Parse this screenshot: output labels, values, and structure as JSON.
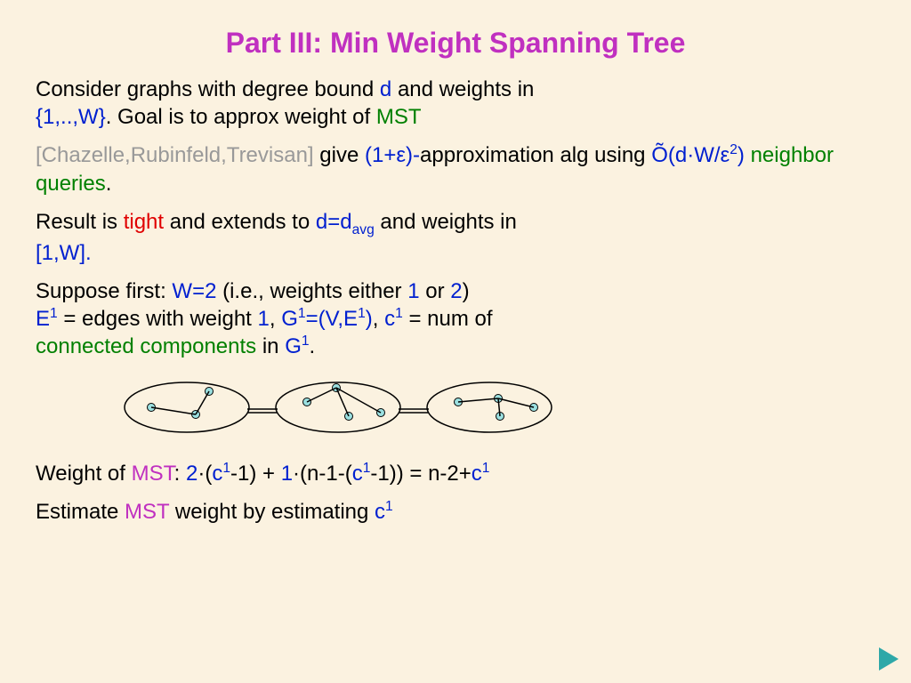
{
  "title": "Part III: Min Weight Spanning Tree",
  "p1": {
    "t1": "Consider graphs with degree bound ",
    "d": "d",
    "t2": " and weights in",
    "set": "{1,..,W}",
    "t3": ". Goal is to approx weight of ",
    "mst": "MST"
  },
  "p2": {
    "cite": "[Chazelle,Rubinfeld,Trevisan]",
    "t1": " give ",
    "approx": "(1+ε)-",
    "t2": "approximation alg using ",
    "tilde": "Õ(d·W/ε",
    "sup": "2",
    "close": ")",
    "t3": " ",
    "nq": "neighbor queries",
    "dot": "."
  },
  "p3": {
    "t1": "Result is ",
    "tight": "tight",
    "t2": " and extends to ",
    "dd": "d=d",
    "avg": "avg",
    "t3": " and weights in",
    "range": "[1,W]."
  },
  "p4": {
    "t1": "Suppose first: ",
    "w2": "W=2",
    "t2": " (i.e., weights either ",
    "one": "1",
    "t3": " or ",
    "two": "2",
    "t4": ")",
    "e": "E",
    "e_sup": "1",
    "t5": " = edges with weight ",
    "one2": "1",
    "t6": ", ",
    "g1def": "G",
    "g1sup": "1",
    "eq": "=(V,E",
    "esup2": "1",
    "close2": ")",
    "t7": ", ",
    "c": "c",
    "csup": "1",
    "t8": " = num of",
    "cc": "connected components",
    "t9": " in ",
    "g": "G",
    "gsup": "1",
    "t10": "."
  },
  "p5": {
    "t1": "Weight of ",
    "mst": "MST",
    "t2": ": ",
    "two": "2",
    "t3": "·(",
    "c1a": "c",
    "c1asup": "1",
    "t4": "-1) + ",
    "one": "1",
    "t5": "·(n-1-(",
    "c1b": "c",
    "c1bsup": "1",
    "t6": "-1)) = n-2+",
    "c1c": "c",
    "c1csup": "1"
  },
  "p6": {
    "t1": "Estimate ",
    "mst": "MST",
    "t2": " weight by estimating ",
    "c": "c",
    "csup": "1"
  }
}
